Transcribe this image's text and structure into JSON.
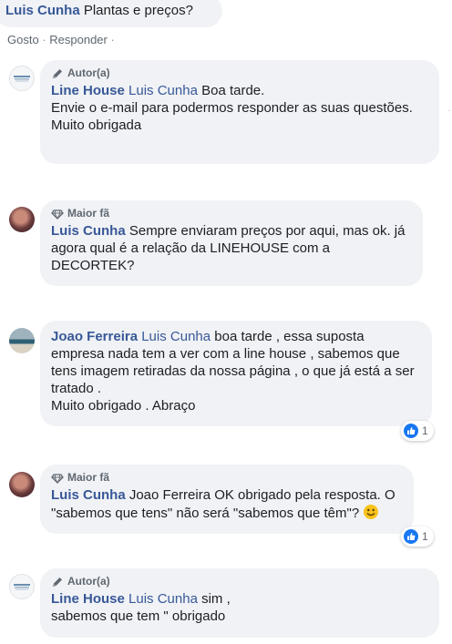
{
  "top_comment": {
    "author": "Luis Cunha",
    "text": "Plantas e preços?",
    "actions": [
      "Gosto",
      "Responder"
    ]
  },
  "comments": [
    {
      "badge": "Autor(a)",
      "author": "Line House",
      "mention": "Luis Cunha",
      "lines": [
        "Boa tarde.",
        "Envie o e-mail para podermos responder as suas questões.",
        "Muito obrigada"
      ]
    },
    {
      "badge": "Maior fã",
      "author": "Luis Cunha",
      "text": "Sempre enviaram preços por aqui, mas ok. já agora qual é a relação da LINEHOUSE com a DECORTEK?"
    },
    {
      "author": "Joao Ferreira",
      "mention": "Luis Cunha",
      "text": "boa tarde , essa suposta empresa nada tem a ver com a line house , sabemos que tens imagem retiradas da nossa página , o que já está a ser tratado .",
      "line2": "Muito obrigado . Abraço",
      "reactions": "1"
    },
    {
      "badge": "Maior fã",
      "author": "Luis Cunha",
      "text": "Joao Ferreira OK obrigado pela resposta. O \"sabemos que tens\" não será \"sabemos que têm\"?",
      "reactions": "1"
    },
    {
      "badge": "Autor(a)",
      "author": "Line House",
      "mention": "Luis Cunha",
      "text": "sim , sabemos que tem \" obrigado"
    }
  ],
  "colors": {
    "link": "#385898",
    "bubble": "#f0f2f5",
    "like": "#1877f2"
  }
}
